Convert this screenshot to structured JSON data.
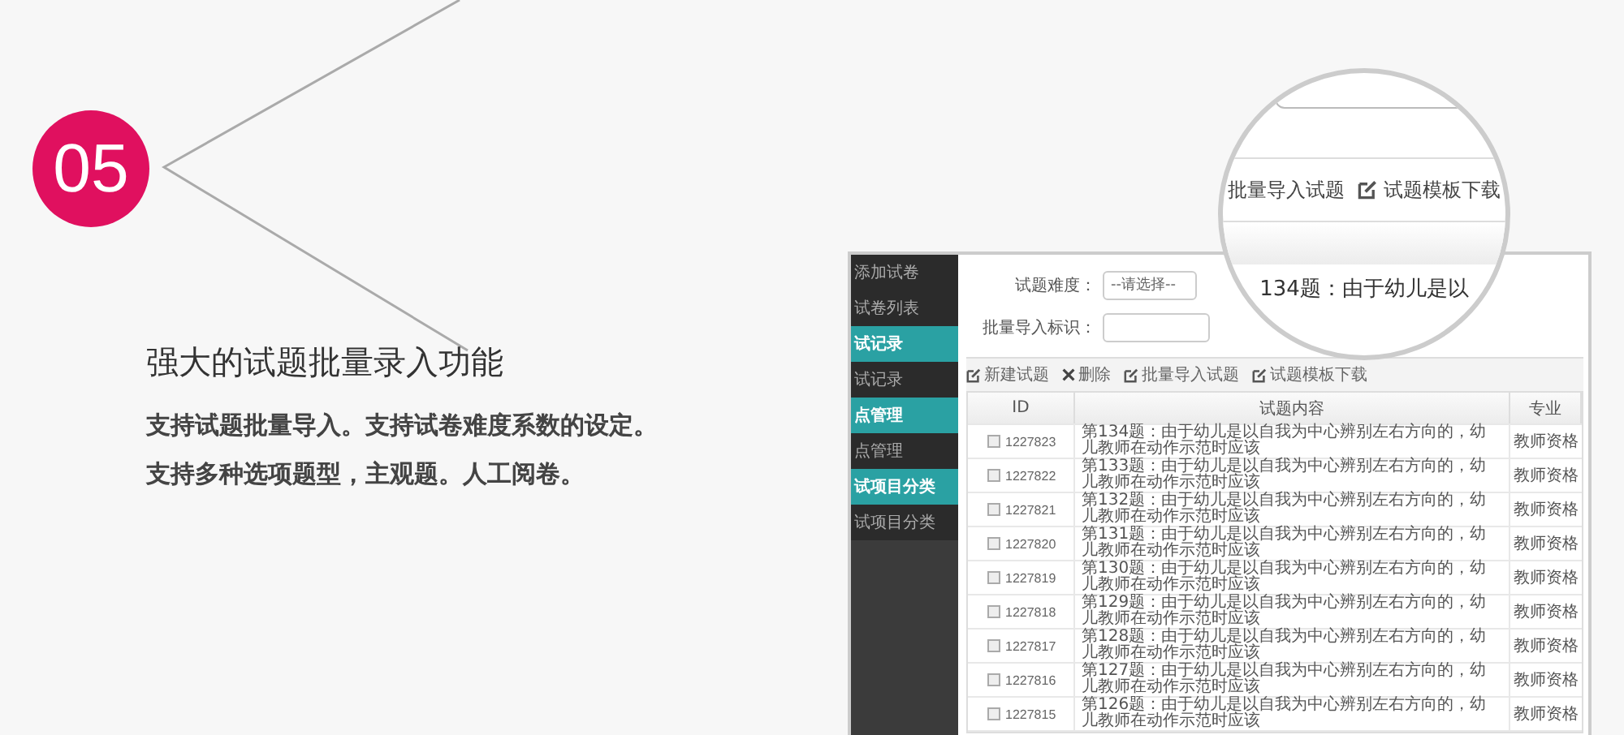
{
  "badge": "05",
  "heading": "强大的试题批量录入功能",
  "description": [
    "支持试题批量导入。支持试卷难度系数的设定。",
    "支持多种选项题型，主观题。人工阅卷。"
  ],
  "sidebar": [
    {
      "label": "添加试卷",
      "kind": "item"
    },
    {
      "label": "试卷列表",
      "kind": "item"
    },
    {
      "label": "试记录",
      "kind": "header"
    },
    {
      "label": "试记录",
      "kind": "item"
    },
    {
      "label": "点管理",
      "kind": "header"
    },
    {
      "label": "点管理",
      "kind": "item"
    },
    {
      "label": "试项目分类",
      "kind": "header"
    },
    {
      "label": "试项目分类",
      "kind": "item"
    }
  ],
  "form": [
    {
      "label": "试题难度：",
      "kind": "select",
      "value": "--请选择--"
    },
    {
      "label": "批量导入标识：",
      "kind": "input"
    }
  ],
  "toolbar": [
    {
      "label": "新建试题",
      "kind": "edit"
    },
    {
      "label": "删除",
      "kind": "delete"
    },
    {
      "label": "批量导入试题",
      "kind": "edit"
    },
    {
      "label": "试题模板下载",
      "kind": "edit"
    }
  ],
  "table": {
    "columns": [
      "ID",
      "试题内容",
      "专业"
    ],
    "rows": [
      {
        "id": "1227823",
        "checked": false,
        "content": "第134题：由于幼儿是以自我为中心辨别左右方向的，幼儿教师在动作示范时应该",
        "major": "教师资格"
      },
      {
        "id": "1227822",
        "checked": false,
        "content": "第133题：由于幼儿是以自我为中心辨别左右方向的，幼儿教师在动作示范时应该",
        "major": "教师资格"
      },
      {
        "id": "1227821",
        "checked": false,
        "content": "第132题：由于幼儿是以自我为中心辨别左右方向的，幼儿教师在动作示范时应该",
        "major": "教师资格"
      },
      {
        "id": "1227820",
        "checked": false,
        "content": "第131题：由于幼儿是以自我为中心辨别左右方向的，幼儿教师在动作示范时应该",
        "major": "教师资格"
      },
      {
        "id": "1227819",
        "checked": false,
        "content": "第130题：由于幼儿是以自我为中心辨别左右方向的，幼儿教师在动作示范时应该",
        "major": "教师资格"
      },
      {
        "id": "1227818",
        "checked": false,
        "content": "第129题：由于幼儿是以自我为中心辨别左右方向的，幼儿教师在动作示范时应该",
        "major": "教师资格"
      },
      {
        "id": "1227817",
        "checked": false,
        "content": "第128题：由于幼儿是以自我为中心辨别左右方向的，幼儿教师在动作示范时应该",
        "major": "教师资格"
      },
      {
        "id": "1227816",
        "checked": false,
        "content": "第127题：由于幼儿是以自我为中心辨别左右方向的，幼儿教师在动作示范时应该",
        "major": "教师资格"
      },
      {
        "id": "1227815",
        "checked": false,
        "content": "第126题：由于幼儿是以自我为中心辨别左右方向的，幼儿教师在动作示范时应该",
        "major": "教师资格"
      }
    ]
  },
  "magnifier": {
    "toolbar": [
      {
        "label": "批量导入试题",
        "kind": "plain"
      },
      {
        "label": "试题模板下载",
        "kind": "edit"
      }
    ],
    "preview": "134题：由于幼儿是以"
  }
}
